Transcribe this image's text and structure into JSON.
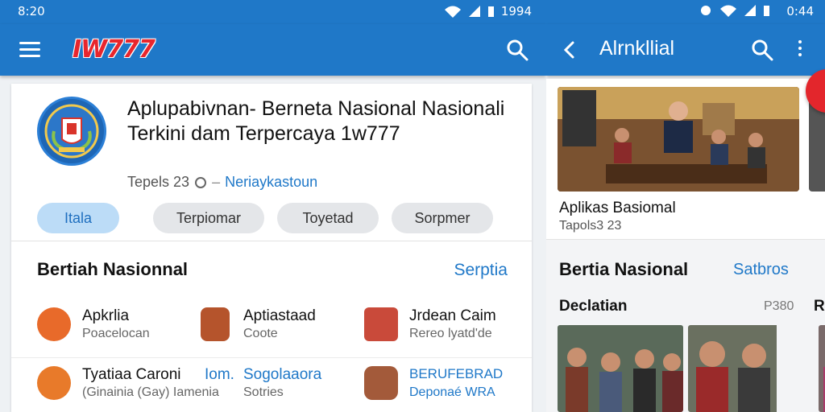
{
  "left": {
    "status": {
      "time": "8:20",
      "battery": "1994"
    },
    "appbar": {
      "logo": "IW777"
    },
    "headline": "Aplupabivnan- Berneta Nasional Nasionali Terkini dam Terpercaya 1w777",
    "meta": {
      "date": "Tepels 23",
      "source": "Neriaykastoun"
    },
    "chips": [
      {
        "label": "Itala",
        "active": true
      },
      {
        "label": "Terpiomar",
        "active": false
      },
      {
        "label": "Toyetad",
        "active": false
      },
      {
        "label": "Sorpmer",
        "active": false
      }
    ],
    "section": {
      "title": "Bertiah Nasionnal",
      "link": "Serptia"
    },
    "items": [
      {
        "title": "Apkrlia",
        "sub": "Poacelocan",
        "title_blue": false,
        "sub_blue": false
      },
      {
        "title": "Aptiastaad",
        "sub": "Coote",
        "title_blue": false,
        "sub_blue": false
      },
      {
        "title": "Jrdean Caim",
        "sub": "Rereo lyatd'de",
        "title_blue": false,
        "sub_blue": false
      },
      {
        "title": "Tyatiaa Caroni",
        "sub": "(Ginainia (Gay) Iamenia",
        "title_blue": false,
        "sub_blue": false
      },
      {
        "title": "Sogolaaora",
        "sub": "Sotries",
        "title_blue": true,
        "sub_blue": false
      },
      {
        "title": "BERUFEBRAD",
        "sub": "Deponaé WRA",
        "title_blue": true,
        "sub_blue": true
      }
    ],
    "extra_label": "Iom."
  },
  "right": {
    "status": {
      "time": "0:44"
    },
    "appbar": {
      "title": "Alrnkllial"
    },
    "featured": {
      "caption": "Aplikas Basiomal",
      "meta": "Tapols3 23"
    },
    "section": {
      "title": "Bertia Nasional",
      "link": "Satbros"
    },
    "sub": {
      "title": "Declatian",
      "count": "P380",
      "extra": "R"
    }
  },
  "colors": {
    "primary": "#1f78c8",
    "accent": "#e3262c"
  }
}
